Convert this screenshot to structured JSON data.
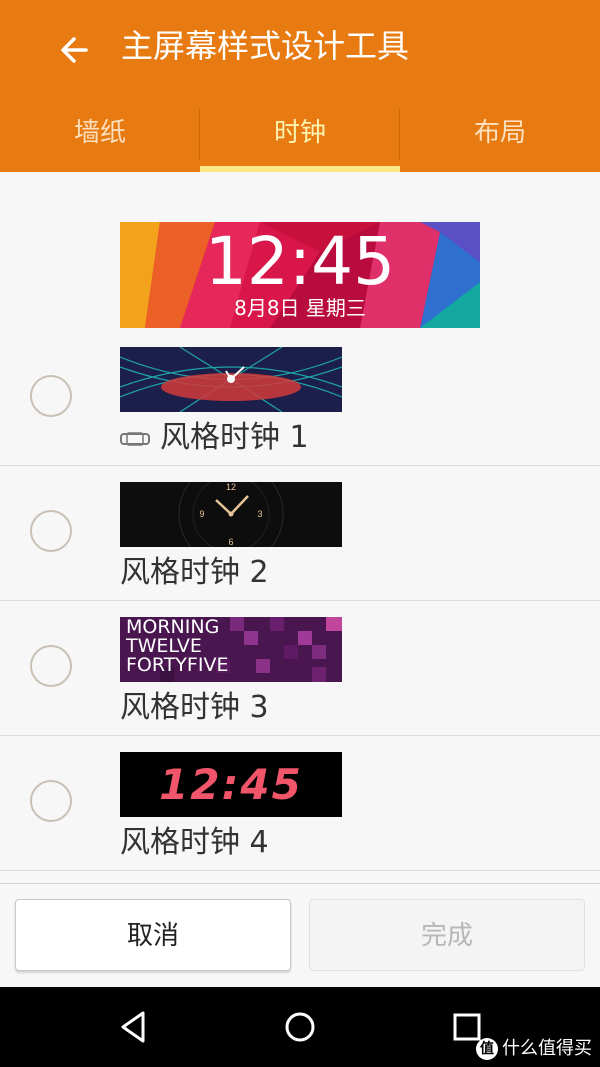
{
  "header": {
    "title": "主屏幕样式设计工具"
  },
  "tabs": [
    {
      "label": "墙纸"
    },
    {
      "label": "时钟",
      "active": true
    },
    {
      "label": "布局"
    }
  ],
  "preview": {
    "time": "12:45",
    "date": "8月8日  星期三"
  },
  "clock_styles": [
    {
      "label": "风格时钟 1",
      "selected": false,
      "has_watch_icon": true
    },
    {
      "label": "风格时钟 2",
      "selected": false
    },
    {
      "label": "风格时钟 3",
      "selected": false,
      "thumb_text": [
        "MORNING",
        "TWELVE",
        "FORTYFIVE"
      ]
    },
    {
      "label": "风格时钟 4",
      "selected": false,
      "thumb_text": "12:45"
    }
  ],
  "clock2_numbers": {
    "n12": "12",
    "n3": "3",
    "n6": "6",
    "n9": "9"
  },
  "buttons": {
    "cancel": "取消",
    "done": "完成"
  },
  "watermark": {
    "badge": "值",
    "text": "什么值得买"
  },
  "colors": {
    "accent": "#e77a10",
    "tab_indicator": "#fde887"
  }
}
